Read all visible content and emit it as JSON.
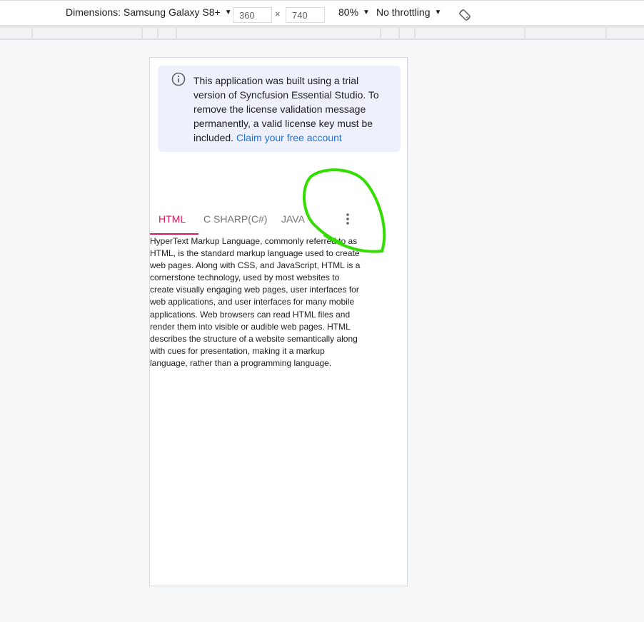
{
  "devtools": {
    "dimensions_label": "Dimensions: Samsung Galaxy S8+",
    "width_value": "360",
    "times_symbol": "×",
    "height_value": "740",
    "zoom": "80%",
    "throttling": "No throttling",
    "caret": "▼",
    "rotate_icon": "rotate-icon"
  },
  "license_banner": {
    "message": "This application was built using a trial version of Syncfusion Essential Studio. To remove the license validation message permanently, a valid license key must be included.",
    "link_text": "Claim your free account",
    "icon": "info-icon"
  },
  "tabs": {
    "items": [
      {
        "label": "HTML",
        "active": true
      },
      {
        "label": "C SHARP(C#)",
        "active": false
      },
      {
        "label": "JAVA",
        "active": false
      }
    ],
    "overflow_icon": "more-vertical-icon"
  },
  "content": {
    "text": "HyperText Markup Language, commonly referred to as HTML, is the standard markup language used to create web pages. Along with CSS, and JavaScript, HTML is a cornerstone technology, used by most websites to create visually engaging web pages, user interfaces for web applications, and user interfaces for many mobile applications. Web browsers can read HTML files and render them into visible or audible web pages. HTML describes the structure of a website semantically along with cues for presentation, making it a markup language, rather than a programming language."
  },
  "colors": {
    "accent": "#e3165b",
    "link": "#1a73e8",
    "banner_bg": "#eef1fb",
    "annotation": "#33dd00"
  }
}
